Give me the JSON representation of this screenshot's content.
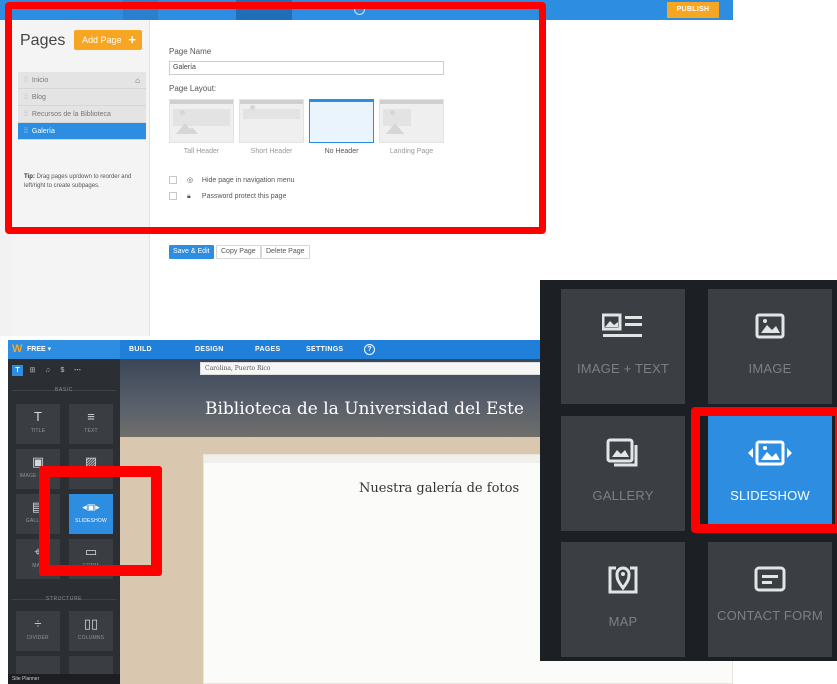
{
  "top_panel": {
    "publish_label": "PUBLISH",
    "sidebar": {
      "title": "Pages",
      "add_page_label": "Add Page",
      "add_page_icon": "plus-icon",
      "pages": [
        {
          "label": "Inicio",
          "home": true
        },
        {
          "label": "Blog"
        },
        {
          "label": "Recursos de la Biblioteca"
        },
        {
          "label": "Galería",
          "active": true
        }
      ],
      "tip_bold": "Tip:",
      "tip_text": "Drag pages up/down to reorder and left/right to create subpages."
    },
    "settings": {
      "page_name_label": "Page Name",
      "page_name_value": "Galería",
      "page_layout_label": "Page Layout:",
      "layouts": [
        "Tall Header",
        "Short Header",
        "No Header",
        "Landing Page"
      ],
      "selected_layout": "No Header",
      "hide_label": "Hide page in navigation menu",
      "password_label": "Password protect this page",
      "save_edit_label": "Save & Edit",
      "copy_page_label": "Copy Page",
      "delete_page_label": "Delete Page"
    }
  },
  "editor": {
    "plan_label": "FREE",
    "nav_tabs": [
      "BUILD",
      "DESIGN",
      "PAGES",
      "SETTINGS"
    ],
    "tools": [
      "T",
      "⊞",
      "♫",
      "$",
      "⋯"
    ],
    "section_basic": "BASIC",
    "section_structure": "STRUCTURE",
    "elements": [
      {
        "label": "TITLE",
        "icon": "T"
      },
      {
        "label": "TEXT",
        "icon": "≡"
      },
      {
        "label": "IMAGE + TEXT",
        "icon": "▣"
      },
      {
        "label": "IMAGE",
        "icon": "▨"
      },
      {
        "label": "GALLERY",
        "icon": "▤"
      },
      {
        "label": "SLIDESHOW",
        "icon": "◂▣▸",
        "selected": true
      },
      {
        "label": "MAP",
        "icon": "⌖"
      },
      {
        "label": "FORM",
        "icon": "▭"
      },
      {
        "label": "DIVIDER",
        "icon": "÷"
      },
      {
        "label": "COLUMNS",
        "icon": "▯▯"
      }
    ],
    "site_planner_label": "Site Planner",
    "address_text": "Carolina, Puerto Rico",
    "site_title": "Biblioteca de la Universidad del Este",
    "gallery_heading": "Nuestra galería de fotos"
  },
  "zoom": {
    "tiles": [
      {
        "label": "IMAGE + TEXT",
        "icon": "image-text-icon"
      },
      {
        "label": "IMAGE",
        "icon": "image-icon"
      },
      {
        "label": "GALLERY",
        "icon": "gallery-icon"
      },
      {
        "label": "SLIDESHOW",
        "icon": "slideshow-icon",
        "selected": true
      },
      {
        "label": "MAP",
        "icon": "map-pin-icon"
      },
      {
        "label": "CONTACT FORM",
        "icon": "contact-form-icon"
      }
    ]
  },
  "colors": {
    "accent_blue": "#2d8de1",
    "accent_orange": "#f6a623",
    "annotation_red": "#ff0000",
    "panel_dark": "#2b2e32"
  }
}
